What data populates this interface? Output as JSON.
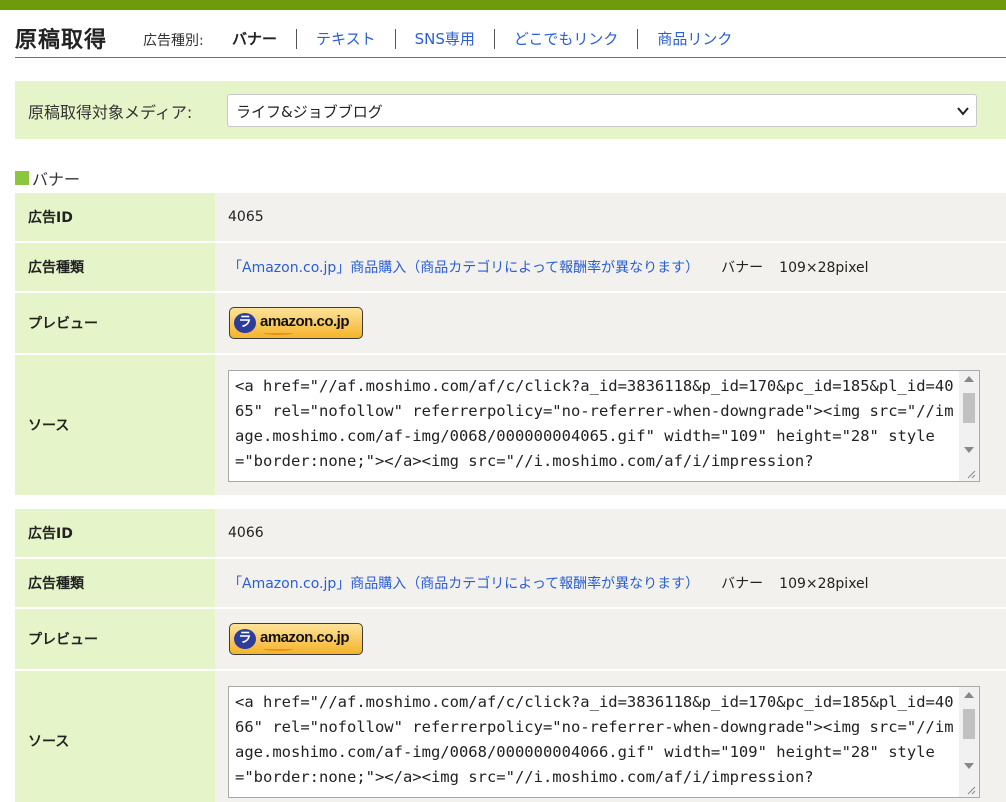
{
  "header": {
    "title": "原稿取得",
    "type_label": "広告種別:",
    "tabs": [
      {
        "label": "バナー",
        "active": true
      },
      {
        "label": "テキスト",
        "active": false
      },
      {
        "label": "SNS専用",
        "active": false
      },
      {
        "label": "どこでもリンク",
        "active": false
      },
      {
        "label": "商品リンク",
        "active": false
      }
    ]
  },
  "media": {
    "label": "原稿取得対象メディア:",
    "selected": "ライフ&ジョブブログ"
  },
  "section": {
    "title": "バナー"
  },
  "row_labels": {
    "id": "広告ID",
    "kind": "広告種類",
    "preview": "プレビュー",
    "source": "ソース"
  },
  "ads": [
    {
      "id": "4065",
      "kind_link": "「Amazon.co.jp」商品購入（商品カテゴリによって報酬率が異なります）",
      "kind_type": "バナー",
      "kind_size": "109×28pixel",
      "banner_text": "amazon.co.jp",
      "source": "<a href=\"//af.moshimo.com/af/c/click?a_id=3836118&p_id=170&pc_id=185&pl_id=4065\" rel=\"nofollow\" referrerpolicy=\"no-referrer-when-downgrade\"><img src=\"//image.moshimo.com/af-img/0068/000000004065.gif\" width=\"109\" height=\"28\" style=\"border:none;\"></a><img src=\"//i.moshimo.com/af/i/impression?"
    },
    {
      "id": "4066",
      "kind_link": "「Amazon.co.jp」商品購入（商品カテゴリによって報酬率が異なります）",
      "kind_type": "バナー",
      "kind_size": "109×28pixel",
      "banner_text": "amazon.co.jp",
      "source": "<a href=\"//af.moshimo.com/af/c/click?a_id=3836118&p_id=170&pc_id=185&pl_id=4066\" rel=\"nofollow\" referrerpolicy=\"no-referrer-when-downgrade\"><img src=\"//image.moshimo.com/af-img/0068/000000004066.gif\" width=\"109\" height=\"28\" style=\"border:none;\"></a><img src=\"//i.moshimo.com/af/i/impression?"
    }
  ],
  "colors": {
    "accent": "#6f9a0c",
    "label_bg": "#e6f5c9",
    "link": "#2a5ed6"
  },
  "icons": {
    "select": "chevron-down-icon",
    "section": "green-square-icon"
  }
}
